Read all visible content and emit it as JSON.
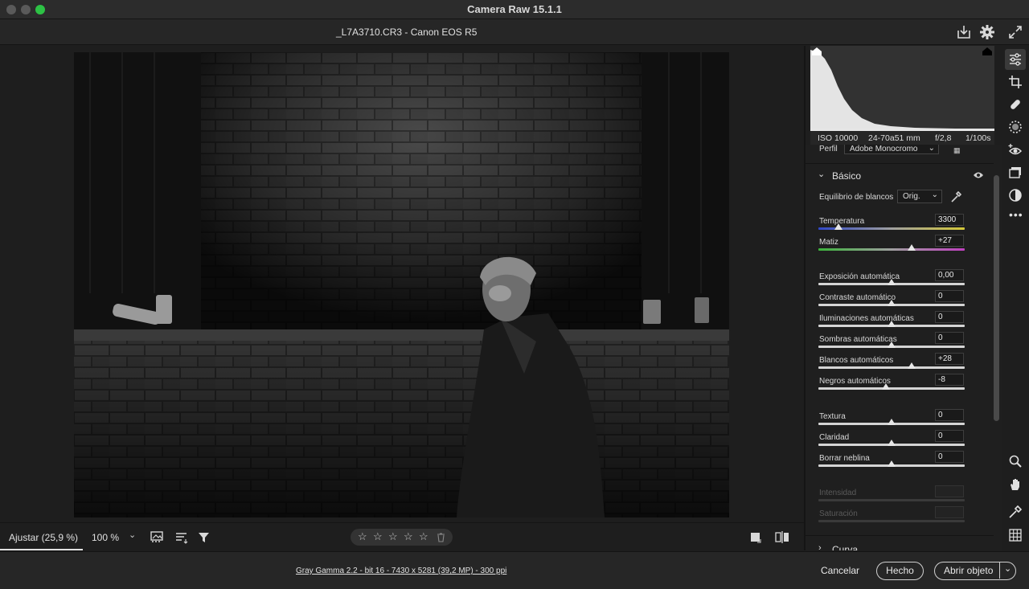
{
  "app": {
    "title": "Camera Raw 15.1.1"
  },
  "file": {
    "name": "_L7A3710.CR3",
    "separator": " - ",
    "camera": "Canon EOS R5"
  },
  "histogram": {
    "iso": "ISO 10000",
    "lens": "24-70a51 mm",
    "aperture": "f/2,8",
    "shutter": "1/100s"
  },
  "profile": {
    "label": "Perfil",
    "value": "Adobe Monocromo"
  },
  "basic": {
    "title": "Básico",
    "wb_label": "Equilibrio de blancos",
    "wb_value": "Orig.",
    "sliders": [
      {
        "label": "Temperatura",
        "value": "3300",
        "level": 0.14,
        "kind": "temp"
      },
      {
        "label": "Matiz",
        "value": "+27",
        "level": 0.635,
        "kind": "tint"
      },
      {
        "label": "Exposición automática",
        "value": "0,00",
        "level": 0.5
      },
      {
        "label": "Contraste automático",
        "value": "0",
        "level": 0.5
      },
      {
        "label": "Iluminaciones automáticas",
        "value": "0",
        "level": 0.5
      },
      {
        "label": "Sombras automáticas",
        "value": "0",
        "level": 0.5
      },
      {
        "label": "Blancos automáticos",
        "value": "+28",
        "level": 0.64
      },
      {
        "label": "Negros automáticos",
        "value": "-8",
        "level": 0.46
      },
      {
        "label": "Textura",
        "value": "0",
        "level": 0.5
      },
      {
        "label": "Claridad",
        "value": "0",
        "level": 0.5
      },
      {
        "label": "Borrar neblina",
        "value": "0",
        "level": 0.5
      },
      {
        "label": "Intensidad",
        "value": "",
        "disabled": true
      },
      {
        "label": "Saturación",
        "value": "",
        "disabled": true
      }
    ]
  },
  "curve": {
    "title": "Curva"
  },
  "bottom": {
    "fit_label": "Ajustar (25,9 %)",
    "zoom_label": "100 %",
    "star_rating": 0,
    "star_count": 5
  },
  "footer": {
    "info": "Gray Gamma 2.2 - bit 16 - 7430 x 5281 (39,2 MP) - 300 ppi",
    "cancel": "Cancelar",
    "done": "Hecho",
    "open": "Abrir objeto"
  },
  "colors": {
    "accent_green": "#2dc245",
    "panel_bg": "#1f1f1f",
    "canvas_bg": "#1e1e1e"
  }
}
